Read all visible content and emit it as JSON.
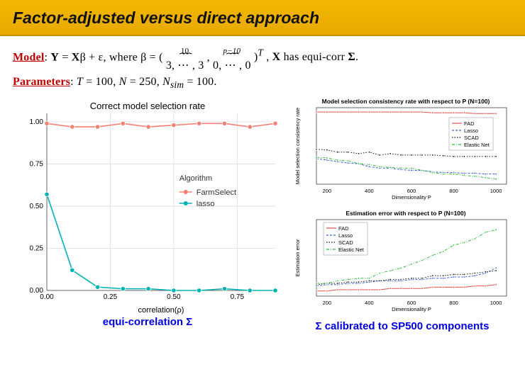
{
  "title": "Factor-adjusted versus direct approach",
  "model": {
    "label": "Model",
    "eq_lead": "Y = Xβ + ε, where β = (",
    "overbrace1_top": "10",
    "overbrace1_body": "3, ⋯ , 3",
    "comma": ",",
    "overbrace2_top": "p−10",
    "overbrace2_body": "0, ⋯ , 0",
    "eq_tail": ")ᵀ , X has equi-corr Σ."
  },
  "params": {
    "label": "Parameters",
    "text": "T = 100, N = 250, N_sim = 100."
  },
  "left_chart": {
    "title": "Correct model selection rate",
    "xlabel": "correlation(ρ)",
    "legend_title": "Algorithm",
    "series_labels": [
      "FarmSelect",
      "lasso"
    ],
    "caption": "equi-correlation Σ",
    "xticks": [
      "0.00",
      "0.25",
      "0.50",
      "0.75"
    ],
    "yticks": [
      "0.00",
      "0.25",
      "0.50",
      "0.75",
      "1.00"
    ]
  },
  "right_charts": {
    "legend": [
      "FAD",
      "Lasso",
      "SCAD",
      "Elastic Net"
    ],
    "top_title": "Model selection consistency rate with respect to P (N=100)",
    "bottom_title": "Estimation error with respect to P (N=100)",
    "xlabel": "Dimensionality P",
    "top_ylabel": "Model selection consistency rate",
    "bottom_ylabel": "Estimation error",
    "xticks": [
      "200",
      "400",
      "600",
      "800",
      "1000"
    ],
    "caption": "Σ calibrated to SP500 components"
  },
  "chart_data": [
    {
      "type": "line",
      "title": "Correct model selection rate",
      "xlabel": "correlation(ρ)",
      "ylabel": "rate",
      "xlim": [
        0,
        0.9
      ],
      "ylim": [
        0,
        1.05
      ],
      "x": [
        0.0,
        0.1,
        0.2,
        0.3,
        0.4,
        0.5,
        0.6,
        0.7,
        0.8,
        0.9
      ],
      "series": [
        {
          "name": "FarmSelect",
          "color": "#f58174",
          "values": [
            0.99,
            0.97,
            0.97,
            0.99,
            0.97,
            0.98,
            0.99,
            0.99,
            0.97,
            0.99,
            0.97
          ]
        },
        {
          "name": "lasso",
          "color": "#00b3b3",
          "values": [
            0.57,
            0.12,
            0.02,
            0.01,
            0.01,
            0.0,
            0.0,
            0.01,
            0.0,
            0.0
          ]
        }
      ]
    },
    {
      "type": "line",
      "title": "Model selection consistency rate with respect to P (N=100)",
      "xlabel": "Dimensionality P",
      "ylabel": "rate",
      "xlim": [
        150,
        1050
      ],
      "ylim": [
        0,
        1.05
      ],
      "x": [
        150,
        200,
        250,
        300,
        350,
        400,
        450,
        500,
        550,
        600,
        650,
        700,
        750,
        800,
        850,
        900,
        950,
        1000
      ],
      "series": [
        {
          "name": "FAD",
          "color": "#e1504a",
          "values": [
            0.99,
            0.99,
            0.99,
            0.99,
            0.99,
            0.99,
            0.99,
            0.99,
            0.99,
            0.99,
            0.99,
            0.98,
            0.98,
            0.98,
            0.98,
            0.97,
            0.97,
            0.97
          ]
        },
        {
          "name": "Lasso",
          "color": "#3a5fd8",
          "values": [
            0.35,
            0.33,
            0.31,
            0.29,
            0.28,
            0.24,
            0.22,
            0.22,
            0.2,
            0.19,
            0.19,
            0.17,
            0.16,
            0.16,
            0.15,
            0.15,
            0.14,
            0.14
          ]
        },
        {
          "name": "SCAD",
          "color": "#111",
          "values": [
            0.48,
            0.47,
            0.44,
            0.44,
            0.42,
            0.44,
            0.4,
            0.42,
            0.4,
            0.4,
            0.4,
            0.4,
            0.39,
            0.38,
            0.38,
            0.38,
            0.38,
            0.38
          ]
        },
        {
          "name": "Elastic Net",
          "color": "#2fbf3a",
          "values": [
            0.37,
            0.36,
            0.33,
            0.32,
            0.28,
            0.27,
            0.24,
            0.23,
            0.22,
            0.22,
            0.19,
            0.16,
            0.14,
            0.14,
            0.12,
            0.11,
            0.09,
            0.07
          ]
        }
      ]
    },
    {
      "type": "line",
      "title": "Estimation error with respect to P (N=100)",
      "xlabel": "Dimensionality P",
      "ylabel": "error",
      "xlim": [
        150,
        1050
      ],
      "ylim": [
        0,
        0.6
      ],
      "x": [
        150,
        200,
        250,
        300,
        350,
        400,
        450,
        500,
        550,
        600,
        650,
        700,
        750,
        800,
        850,
        900,
        950,
        1000
      ],
      "series": [
        {
          "name": "FAD",
          "color": "#e1504a",
          "values": [
            0.04,
            0.04,
            0.05,
            0.05,
            0.05,
            0.05,
            0.05,
            0.06,
            0.06,
            0.06,
            0.06,
            0.07,
            0.07,
            0.07,
            0.07,
            0.08,
            0.08,
            0.09
          ]
        },
        {
          "name": "Lasso",
          "color": "#3a5fd8",
          "values": [
            0.08,
            0.09,
            0.09,
            0.1,
            0.1,
            0.11,
            0.12,
            0.12,
            0.12,
            0.13,
            0.13,
            0.14,
            0.14,
            0.15,
            0.15,
            0.16,
            0.18,
            0.22
          ]
        },
        {
          "name": "SCAD",
          "color": "#111",
          "values": [
            0.09,
            0.1,
            0.1,
            0.11,
            0.11,
            0.12,
            0.12,
            0.13,
            0.13,
            0.14,
            0.14,
            0.16,
            0.16,
            0.17,
            0.17,
            0.18,
            0.19,
            0.2
          ]
        },
        {
          "name": "Elastic Net",
          "color": "#2fbf3a",
          "values": [
            0.1,
            0.1,
            0.12,
            0.13,
            0.14,
            0.14,
            0.18,
            0.2,
            0.22,
            0.25,
            0.28,
            0.32,
            0.35,
            0.4,
            0.42,
            0.45,
            0.5,
            0.52
          ]
        }
      ]
    }
  ]
}
